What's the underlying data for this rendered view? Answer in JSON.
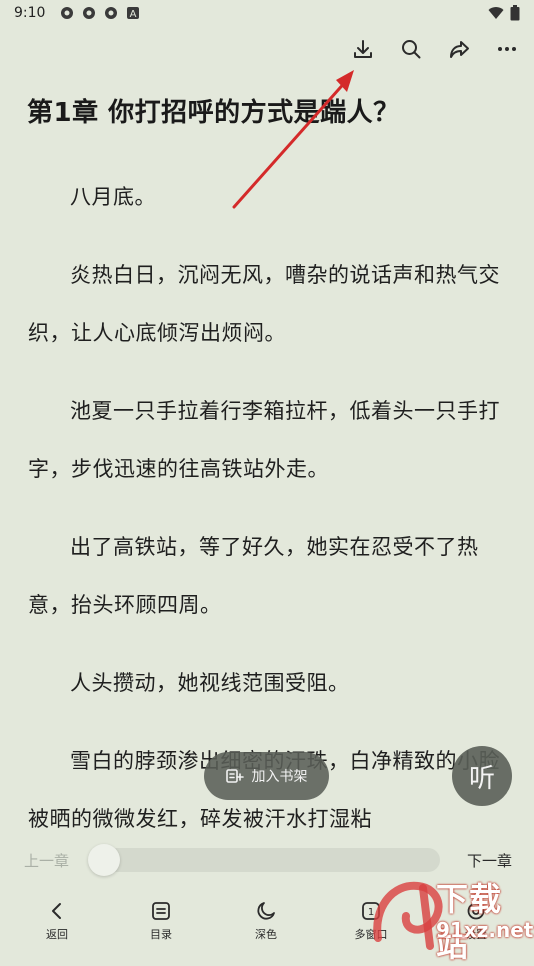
{
  "status_bar": {
    "time": "9:10",
    "notification_icons": [
      "app-icon-1",
      "app-icon-2",
      "app-icon-3",
      "a-icon"
    ],
    "system_icons": [
      "wifi-icon",
      "battery-icon"
    ]
  },
  "top_bar": {
    "actions": [
      "download-icon",
      "search-icon",
      "share-icon",
      "more-icon"
    ]
  },
  "chapter": {
    "title": "第1章 你打招呼的方式是踹人？",
    "paragraphs": [
      "八月底。",
      "炎热白日，沉闷无风，嘈杂的说话声和热气交织，让人心底倾泻出烦闷。",
      "池夏一只手拉着行李箱拉杆，低着头一只手打字，步伐迅速的往高铁站外走。",
      "出了高铁站，等了好久，她实在忍受不了热意，抬头环顾四周。",
      "人头攒动，她视线范围受阻。",
      "雪白的脖颈渗出细密的汗珠，白净精致的小脸被晒的微微发红，碎发被汗水打湿粘"
    ]
  },
  "floating": {
    "add_bookshelf": "加入书架",
    "listen": "听"
  },
  "progress": {
    "prev_label": "上一章",
    "next_label": "下一章",
    "value": 0
  },
  "bottom_nav": {
    "items": [
      {
        "label": "返回",
        "icon": "back-icon"
      },
      {
        "label": "目录",
        "icon": "catalog-icon"
      },
      {
        "label": "深色",
        "icon": "moon-icon"
      },
      {
        "label": "多窗口",
        "icon": "multi-window-icon"
      },
      {
        "label": "设置",
        "icon": "settings-icon"
      }
    ]
  },
  "watermark": {
    "main": "下载站",
    "sub": "91xz.net"
  },
  "colors": {
    "background": "#e3e8db",
    "annotation_arrow": "#d42a2a",
    "overlay_button": "#5a5f58"
  }
}
